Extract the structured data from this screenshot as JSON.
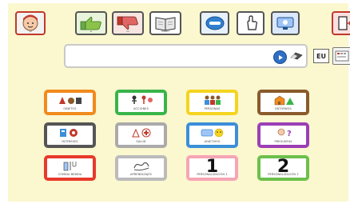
{
  "toolbar": {
    "user_caption": "yo",
    "yes_caption": "sí",
    "no_caption": "no",
    "book_caption": "tablero"
  },
  "textbar": {
    "language_label": "EU"
  },
  "categories": [
    {
      "label": "OBJETOS",
      "color": "#f08a1c"
    },
    {
      "label": "ACCIONES",
      "color": "#39b54a"
    },
    {
      "label": "PERSONAS",
      "color": "#f4d41f"
    },
    {
      "label": "ENTORNOS",
      "color": "#8a5a2b"
    },
    {
      "label": "INTERESES",
      "color": "#555555"
    },
    {
      "label": "SALUD",
      "color": "#aaaaaa"
    },
    {
      "label": "ADJETIVOS",
      "color": "#3b8fd9"
    },
    {
      "label": "PREGUNTAS",
      "color": "#9b3fb5"
    },
    {
      "label": "COMIDA BEBIDA",
      "color": "#e8392b"
    },
    {
      "label": "APRENDIZAJES",
      "color": "#bbbbbb"
    },
    {
      "label": "PERSONALIZACIÓN 1",
      "number": "1",
      "color": "#f5a5b5"
    },
    {
      "label": "PERSONALIZACIÓN 2",
      "number": "2",
      "color": "#6cc04a"
    }
  ]
}
